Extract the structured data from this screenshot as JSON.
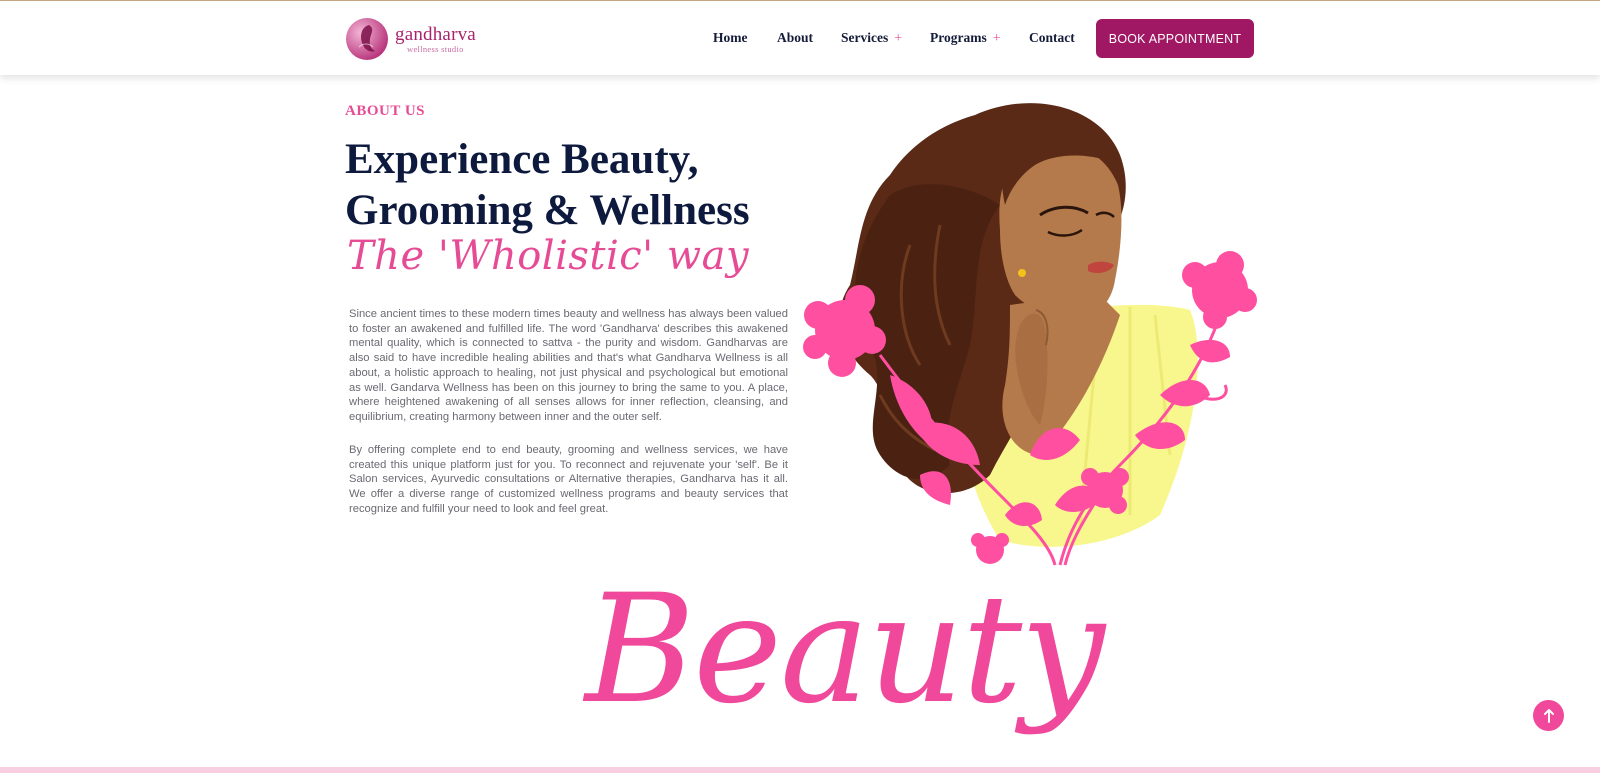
{
  "brand": {
    "name": "gandharva",
    "tagline": "wellness studio"
  },
  "nav": {
    "items": [
      {
        "label": "Home",
        "has_submenu": false
      },
      {
        "label": "About",
        "has_submenu": false
      },
      {
        "label": "Services",
        "has_submenu": true
      },
      {
        "label": "Programs",
        "has_submenu": true
      },
      {
        "label": "Contact",
        "has_submenu": false
      }
    ],
    "submenu_glyph": "+",
    "cta_label": "BOOK APPOINTMENT"
  },
  "about": {
    "eyebrow": "ABOUT US",
    "headline_line1": "Experience Beauty,",
    "headline_line2": "Grooming & Wellness",
    "script_line": "The 'Wholistic' way",
    "paragraph1": "Since ancient times to these modern times beauty and wellness has always been valued to foster an awakened and fulfilled life. The word 'Gandharva' describes this awakened mental quality, which is connected to sattva - the purity and wisdom. Gandharvas are also said to have incredible healing abilities and that's what Gandharva Wellness is all about, a holistic approach to healing, not just physical and psychological but emotional as well. Gandarva Wellness has been on this journey to bring the same to you. A place, where heightened awakening of all senses allows for inner reflection, cleansing, and equilibrium, creating harmony between inner and the outer self.",
    "paragraph2": "By offering complete end to end beauty, grooming and wellness services, we have created this unique platform just for you. To reconnect and rejuvenate your 'self'. Be it Salon services, Ayurvedic consultations or Alternative therapies, Gandharva has it all. We offer a diverse range of customized wellness programs and beauty services that recognize and fulfill your need to look and feel great."
  },
  "section_title": "Beauty",
  "scroll_top_icon": "arrow-up-icon",
  "colors": {
    "brand_magenta": "#a01764",
    "accent_pink": "#e64c96",
    "navy": "#0d1a3d",
    "hair": "#5a2a16",
    "skin": "#b57a4c",
    "dress": "#f8f78e"
  }
}
